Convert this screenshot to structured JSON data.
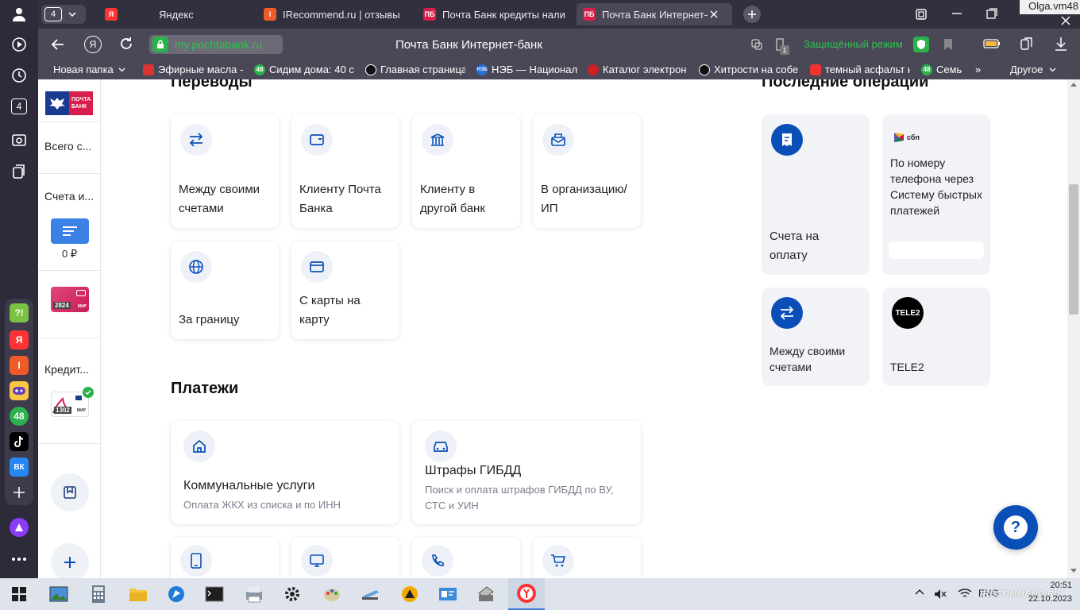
{
  "sidebar": {
    "tab_count": "4",
    "app_labels": [
      "?!",
      "Я",
      "I",
      "",
      "48",
      "",
      "ВК"
    ]
  },
  "tabs": [
    {
      "label": "Яндекс",
      "favicon": "Я"
    },
    {
      "label": "IRecommend.ru | отзывы",
      "favicon": "I"
    },
    {
      "label": "Почта Банк кредиты нали",
      "favicon": "ПБ"
    },
    {
      "label": "Почта Банк Интернет-б",
      "favicon": "ПБ"
    }
  ],
  "window": {
    "tab_counter": "4",
    "watermark_user": "Olga.vm48"
  },
  "address": {
    "url": "my.pochtabank.ru",
    "page_title": "Почта Банк Интернет-банк",
    "protect_label": "Защищённый режим",
    "badge": "1"
  },
  "bookmarks": [
    {
      "label": "Новая папка"
    },
    {
      "label": "Эфирные масла -"
    },
    {
      "label": "Сидим дома: 40 с"
    },
    {
      "label": "Главная страница"
    },
    {
      "label": "НЭБ — Национал"
    },
    {
      "label": "Каталог электрон"
    },
    {
      "label": "Хитрости на собе"
    },
    {
      "label": "темный асфальт н"
    },
    {
      "label": "Семь"
    }
  ],
  "bookmarks_more": "»",
  "bookmarks_other": "Другое",
  "bookmark_icons": {
    "b3": "48",
    "b5": "НЭБ",
    "b9": "48"
  },
  "left": {
    "logo": "ПОЧТА БАНК",
    "total_label": "Всего с...",
    "accounts_label": "Счета и...",
    "balance": "0 ₽",
    "card1": "2824",
    "card1_brand": "МИР",
    "credit_label": "Кредит...",
    "card2": "1302",
    "card2_brand": "МИР"
  },
  "transfers": {
    "heading": "Переводы",
    "items": [
      {
        "label": "Между своими счетами",
        "icon": "arrows-icon"
      },
      {
        "label": "Клиенту Почта Банка",
        "icon": "wallet-icon"
      },
      {
        "label": "Клиенту в другой банк",
        "icon": "bank-icon"
      },
      {
        "label": "В организацию/ ИП",
        "icon": "envelope-icon"
      },
      {
        "label": "За границу",
        "icon": "globe-icon"
      },
      {
        "label": "С карты на карту",
        "icon": "card-icon"
      }
    ]
  },
  "payments": {
    "heading": "Платежи",
    "items": [
      {
        "title": "Коммунальные услуги",
        "subtitle": "Оплата ЖКХ из списка и по ИНН"
      },
      {
        "title": "Штрафы ГИБДД",
        "subtitle": "Поиск и оплата штрафов ГИБДД по ВУ, СТС и УИН"
      }
    ]
  },
  "recent": {
    "heading": "Последние операции",
    "items": [
      {
        "label": "Счета на оплату"
      },
      {
        "label": "По номеру телефона через Систему быстрых платежей",
        "logo": "сбп"
      },
      {
        "label": "Между своими счетами"
      },
      {
        "label": "TELE2",
        "logo": "TELE2"
      }
    ]
  },
  "help_button": "?",
  "taskbar": {
    "lang": "ENG",
    "time": "20:51",
    "date": "22.10.2023",
    "watermark": "IRECOMMEND.RU"
  },
  "colors": {
    "brand_blue": "#0a4fb8",
    "sidebar_bg": "#2d2b3a",
    "tab_bg": "#322f3f",
    "green": "#2bb24c"
  }
}
